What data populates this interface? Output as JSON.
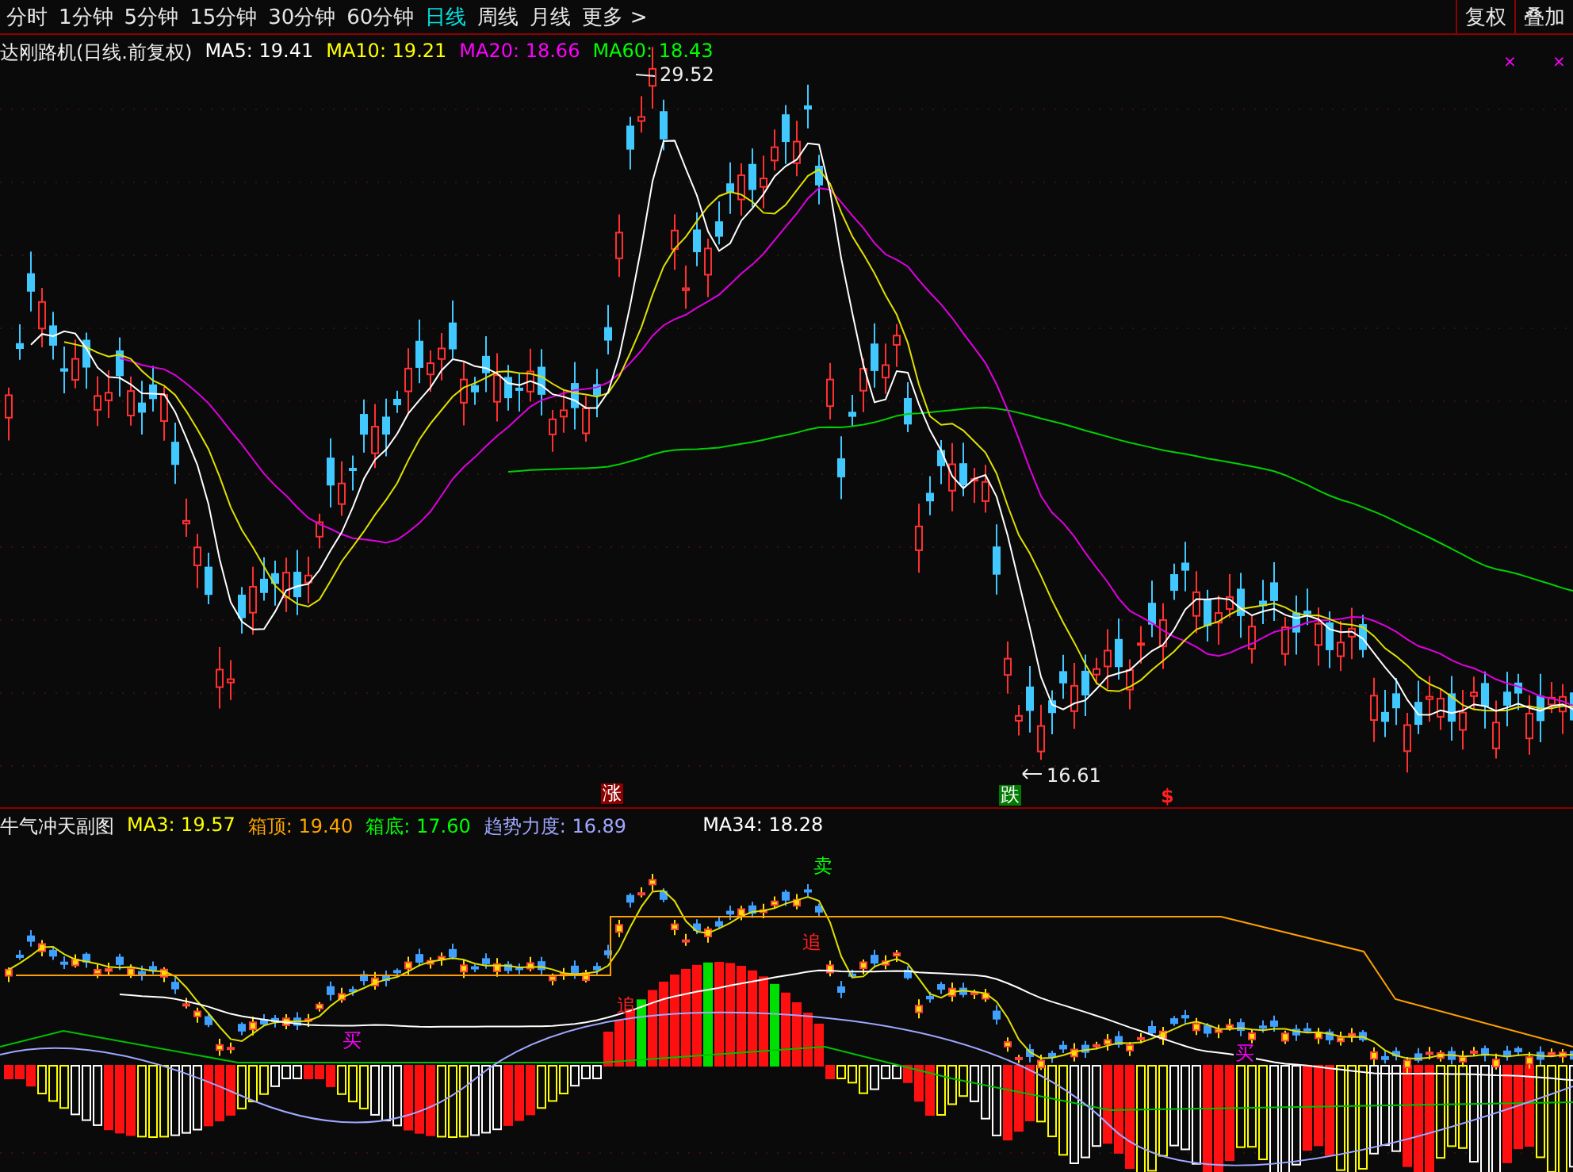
{
  "toolbar": {
    "periods": [
      {
        "label": "分时",
        "selected": false
      },
      {
        "label": "1分钟",
        "selected": false
      },
      {
        "label": "5分钟",
        "selected": false
      },
      {
        "label": "15分钟",
        "selected": false
      },
      {
        "label": "30分钟",
        "selected": false
      },
      {
        "label": "60分钟",
        "selected": false
      },
      {
        "label": "日线",
        "selected": true
      },
      {
        "label": "周线",
        "selected": false
      },
      {
        "label": "月线",
        "selected": false
      },
      {
        "label": "更多 >",
        "selected": false
      }
    ],
    "buttons": [
      "复权",
      "叠加"
    ]
  },
  "main_chart": {
    "title": "达刚路机(日线.前复权)",
    "legend": [
      {
        "label": "MA5: 19.41",
        "color": "#ffffff"
      },
      {
        "label": "MA10: 19.21",
        "color": "#ffff00"
      },
      {
        "label": "MA20: 18.66",
        "color": "#ff00ff"
      },
      {
        "label": "MA60: 18.43",
        "color": "#00ff00"
      }
    ],
    "close_marks": [
      "×",
      "×"
    ],
    "high_label": "29.52",
    "low_label": "16.61",
    "signals": [
      {
        "kind": "rise",
        "text": "涨"
      },
      {
        "kind": "fall",
        "text": "跌"
      },
      {
        "kind": "dollar",
        "text": "$"
      }
    ]
  },
  "sub_chart": {
    "title": "牛气冲天副图",
    "legend": [
      {
        "label": "MA3: 19.57",
        "color": "#ffff00"
      },
      {
        "label": "箱顶: 19.40",
        "color": "#ffa500"
      },
      {
        "label": "箱底: 17.60",
        "color": "#00ff00"
      },
      {
        "label": "趋势力度: 16.89",
        "color": "#a0a8ff"
      },
      {
        "label": "MA34: 18.28",
        "color": "#ffffff"
      }
    ],
    "signals": [
      {
        "kind": "sell",
        "text": "卖"
      },
      {
        "kind": "buy",
        "text": "买"
      },
      {
        "kind": "buy",
        "text": "买"
      },
      {
        "kind": "chase",
        "text": "追"
      },
      {
        "kind": "chase",
        "text": "追"
      }
    ]
  }
}
